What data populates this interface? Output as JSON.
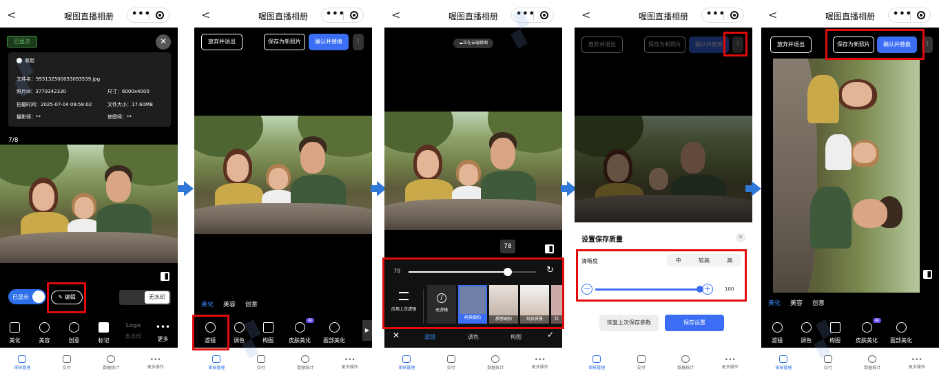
{
  "app": {
    "title": "喔图直播相册",
    "back": "<",
    "more": "•••"
  },
  "bottom_nav": [
    {
      "label": "审核管理",
      "active": true
    },
    {
      "label": "交付",
      "active": false
    },
    {
      "label": "数据统计",
      "active": false
    },
    {
      "label": "更多操作",
      "active": false
    }
  ],
  "panel1": {
    "shown_badge": "已显示",
    "collapse": "收起",
    "info": {
      "filename": "文件名：955132500053093539.jpg",
      "photo_id": "照片id：3779342330",
      "size": "尺寸：6000x4000",
      "shot_time": "拍摄时间：2025-07-04 09:58:02",
      "file_size": "文件大小：17.60MB",
      "photographer": "摄影师：**",
      "retoucher": "修图师：**"
    },
    "counter": "7/8",
    "toggle_label": "已显示",
    "edit_button": "编辑",
    "watermark_button": "无水印",
    "tools": [
      "美化",
      "美容",
      "创意",
      "标记",
      "去水印",
      "更多"
    ],
    "logo_text": "Logo"
  },
  "panel2": {
    "discard": "放弃并退出",
    "save_new": "保存为新照片",
    "confirm": "确认并替换",
    "tabs": [
      "美化",
      "美容",
      "创意"
    ],
    "tools": [
      "滤镜",
      "调色",
      "构图",
      "皮肤美化",
      "面部美化"
    ],
    "ai_badge": "AI"
  },
  "panel3": {
    "cloud_status": "正在云端修图",
    "value_bubble": "78",
    "slider_value": "78",
    "slider_fraction": 0.78,
    "apply_last": "应用上次滤镜",
    "no_filter": "无滤镜",
    "filters": [
      "经典跟拍",
      "质感跟拍",
      "纯白背景",
      "红"
    ],
    "bottom_tabs": [
      "滤镜",
      "调色",
      "构图"
    ]
  },
  "panel4": {
    "discard": "放弃并退出",
    "save_new": "保存为新照片",
    "confirm": "确认并替换",
    "dialog_title": "设置保存质量",
    "clarity_label": "清晰度",
    "clarity_options": [
      "中",
      "较高",
      "高"
    ],
    "quality_value": "100",
    "quality_fraction": 1.0,
    "restore_button": "恢复上次保存参数",
    "save_button": "保存设置"
  },
  "panel5": {
    "discard": "放弃并退出",
    "save_new": "保存为新照片",
    "confirm": "确认并替换",
    "tabs": [
      "美化",
      "美容",
      "创意"
    ],
    "tools": [
      "滤镜",
      "调色",
      "构图",
      "皮肤美化",
      "面部美化"
    ],
    "ai_badge": "AI"
  },
  "colors": {
    "accent": "#3b6ef5",
    "highlight_box": "#e20b0b",
    "arrow": "#2f78d8",
    "ai_badge": "#6a4cf0"
  }
}
